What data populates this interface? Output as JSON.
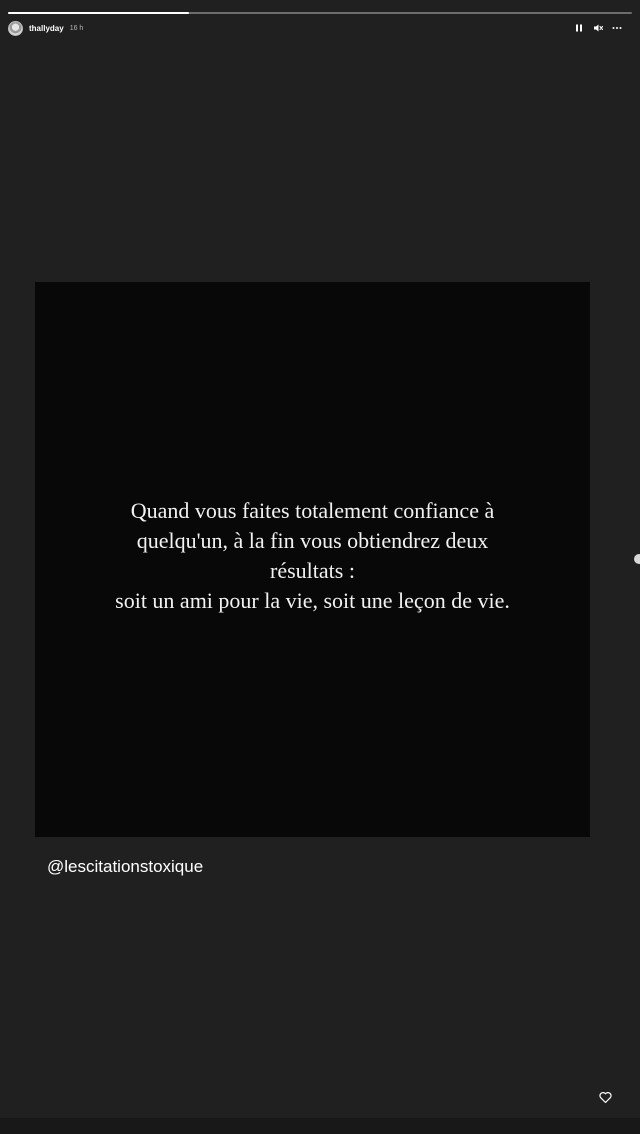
{
  "story": {
    "progress": 0.29,
    "username": "thallyday",
    "time_ago": "16 h",
    "icons": {
      "avatar": "avatar",
      "pause": "pause-icon",
      "volume": "volume-muted-icon",
      "more": "more-options-icon",
      "like": "heart-icon",
      "next": "chevron-right-icon"
    }
  },
  "post": {
    "quote_lines": [
      "Quand vous faites totalement confiance à",
      "quelqu'un, à la fin vous obtiendrez deux",
      "résultats :",
      "soit un ami pour la vie, soit une leçon de vie."
    ]
  },
  "mention": "@lescitationstoxique",
  "colors": {
    "background": "#202020",
    "post_background": "#080808",
    "text": "#f2f2f2"
  }
}
